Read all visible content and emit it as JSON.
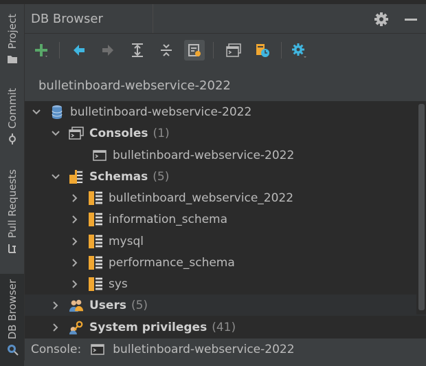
{
  "sidebar": {
    "tabs": [
      {
        "label": "Project",
        "icon": "folder-icon"
      },
      {
        "label": "Commit",
        "icon": "commit-icon"
      },
      {
        "label": "Pull Requests",
        "icon": "pull-request-icon"
      },
      {
        "label": "DB Browser",
        "icon": "db-browser-icon",
        "active": true
      }
    ]
  },
  "header": {
    "title": "DB Browser"
  },
  "toolbar": {
    "buttons": [
      "add-connection-icon",
      "back-icon",
      "forward-icon",
      "expand-all-icon",
      "collapse-all-icon",
      "filter-objects-icon",
      "open-console-icon",
      "session-browser-icon",
      "settings-icon"
    ]
  },
  "connection_label": "bulletinboard-webservice-2022",
  "tree": {
    "root": {
      "label": "bulletinboard-webservice-2022"
    },
    "consoles": {
      "label": "Consoles",
      "count": "(1)"
    },
    "console_item": {
      "label": "bulletinboard-webservice-2022"
    },
    "schemas": {
      "label": "Schemas",
      "count": "(5)"
    },
    "schema_items": [
      {
        "label": "bulletinboard_webservice_2022"
      },
      {
        "label": "information_schema"
      },
      {
        "label": "mysql"
      },
      {
        "label": "performance_schema"
      },
      {
        "label": "sys"
      }
    ],
    "users": {
      "label": "Users",
      "count": "(5)"
    },
    "system_privileges": {
      "label": "System privileges",
      "count": "(41)"
    }
  },
  "status": {
    "label": "Console:",
    "value": "bulletinboard-webservice-2022"
  },
  "colors": {
    "background": "#3c3f41",
    "tree_background": "#2b2b2b",
    "accent_green": "#59a869",
    "accent_blue": "#40b6e0",
    "schema_orange": "#f0a732"
  }
}
